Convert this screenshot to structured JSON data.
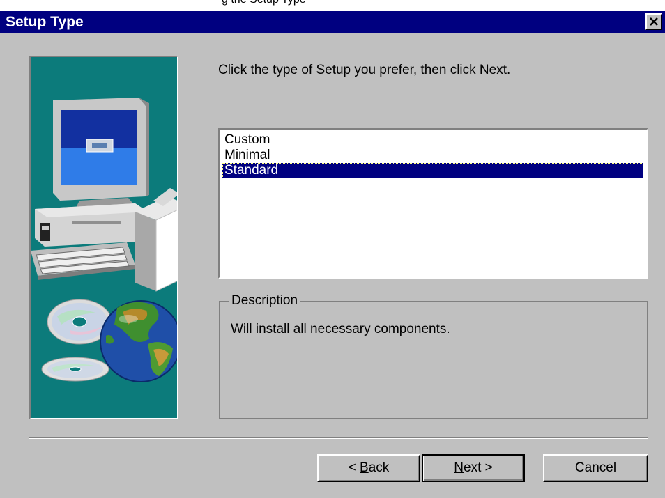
{
  "top_fragment": "g the Setup Type",
  "window": {
    "title": "Setup Type",
    "close_label": "×"
  },
  "instruction": "Click the type of Setup you prefer, then click Next.",
  "setup_types": [
    {
      "label": "Custom",
      "selected": false
    },
    {
      "label": "Minimal",
      "selected": false
    },
    {
      "label": "Standard",
      "selected": true
    }
  ],
  "description": {
    "legend": "Description",
    "text": "Will install all necessary components."
  },
  "buttons": {
    "back_prefix": "< ",
    "back_mnemonic": "B",
    "back_rest": "ack",
    "next_mnemonic": "N",
    "next_rest": "ext >",
    "cancel": "Cancel"
  },
  "colors": {
    "titlebar": "#000080",
    "dialog_face": "#c0c0c0",
    "art_background": "#0c7b7b",
    "selection": "#000080"
  },
  "icons": [
    "computer-icon",
    "cd-disc-icon",
    "globe-icon",
    "close-icon"
  ]
}
